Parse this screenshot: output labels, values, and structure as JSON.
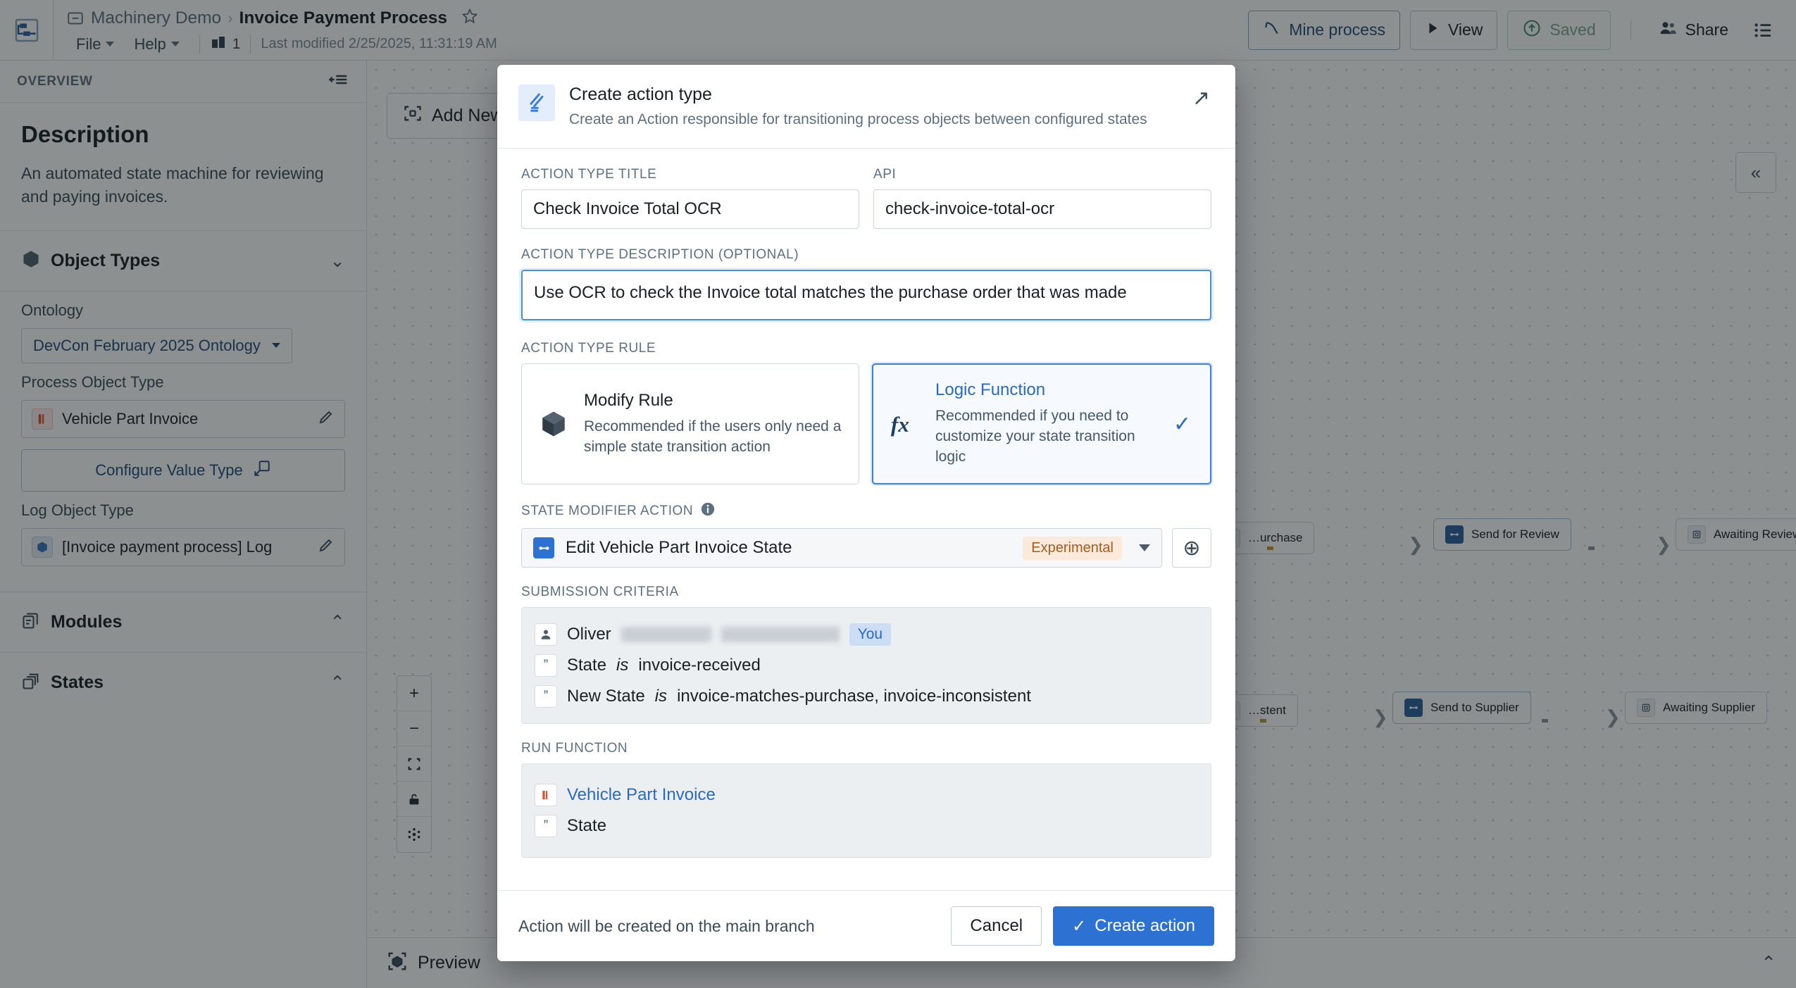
{
  "topbar": {
    "app_icon": "workflow-icon",
    "breadcrumb_parent": "Machinery Demo",
    "breadcrumb_sep": "›",
    "breadcrumb_current": "Invoice Payment Process",
    "star_icon": "star-outline-icon",
    "menu": [
      {
        "label": "File"
      },
      {
        "label": "Help"
      }
    ],
    "branch_count": "1",
    "last_modified": "Last modified 2/25/2025, 11:31:19 AM",
    "actions": {
      "mine_process": "Mine process",
      "view": "View",
      "saved": "Saved",
      "share": "Share",
      "list_icon": "list-menu-icon"
    }
  },
  "left_panel": {
    "header": "OVERVIEW",
    "collapse_icon": "panel-collapse-icon",
    "description_title": "Description",
    "description_text": "An automated state machine for reviewing and paying invoices.",
    "object_types": {
      "title": "Object Types",
      "chevron": "⌄",
      "ontology_label": "Ontology",
      "ontology_value": "DevCon February 2025 Ontology",
      "process_object_type_label": "Process Object Type",
      "process_object_type_value": "Vehicle Part Invoice",
      "configure_value_type": "Configure Value Type",
      "log_object_type_label": "Log Object Type",
      "log_object_type_value": "[Invoice payment process] Log"
    },
    "modules": {
      "title": "Modules",
      "chevron": "⌃"
    },
    "states": {
      "title": "States",
      "chevron": "⌃"
    }
  },
  "canvas": {
    "add_new": "Add New",
    "collapse_right_icon": "«",
    "zoom_controls": [
      "+",
      "−",
      "fit-icon",
      "lock-icon",
      "layout-icon"
    ],
    "nodes": [
      {
        "label": "…urchase",
        "kind": "state"
      },
      {
        "label": "Send for Review",
        "kind": "action"
      },
      {
        "label": "Awaiting Review",
        "kind": "state"
      },
      {
        "label": "…stent",
        "kind": "state"
      },
      {
        "label": "Send to Supplier",
        "kind": "action"
      },
      {
        "label": "Awaiting Supplier",
        "kind": "state"
      }
    ]
  },
  "bottombar": {
    "preview": "Preview",
    "chevron": "⌃"
  },
  "dialog": {
    "header": {
      "icon": "action-type-icon",
      "title": "Create action type",
      "subtitle": "Create an Action responsible for transitioning process objects between configured states",
      "expand_icon": "↗"
    },
    "fields": {
      "title_label": "ACTION TYPE TITLE",
      "title_value": "Check Invoice Total OCR",
      "api_label": "API",
      "api_value": "check-invoice-total-ocr",
      "description_label": "ACTION TYPE DESCRIPTION (OPTIONAL)",
      "description_value": "Use OCR to check the Invoice total matches the purchase order that was made"
    },
    "action_type_rule": {
      "label": "ACTION TYPE RULE",
      "options": [
        {
          "icon": "cube-icon",
          "title": "Modify Rule",
          "description": "Recommended if the users only need a simple state transition action",
          "selected": false
        },
        {
          "icon": "fx-icon",
          "title": "Logic Function",
          "description": "Recommended if you need to customize your state transition logic",
          "selected": true,
          "check": "✓"
        }
      ]
    },
    "state_modifier": {
      "label": "STATE MODIFIER ACTION",
      "info_icon": "info-icon",
      "value": "Edit Vehicle Part Invoice State",
      "tag": "Experimental",
      "add_icon": "⊕"
    },
    "submission_criteria": {
      "label": "SUBMISSION CRITERIA",
      "rows": [
        {
          "icon": "user-icon",
          "text": "Oliver",
          "redacted": true,
          "badge": "You"
        },
        {
          "icon": "quote-icon",
          "key": "State",
          "op": "is",
          "value": "invoice-received"
        },
        {
          "icon": "quote-icon",
          "key": "New State",
          "op": "is",
          "value": "invoice-matches-purchase, invoice-inconsistent"
        }
      ]
    },
    "run_function": {
      "label": "RUN FUNCTION",
      "rows": [
        {
          "icon": "invoice-icon",
          "text": "Vehicle Part Invoice",
          "link": true
        },
        {
          "icon": "quote-icon",
          "text": "State",
          "link": false
        }
      ]
    },
    "footer": {
      "note": "Action will be created on the main branch",
      "cancel": "Cancel",
      "create": "Create action",
      "create_check": "✓"
    }
  },
  "colors": {
    "accent_blue": "#2d72d2",
    "selected_blue": "#3b82d6",
    "experimental_tag_bg": "#fbeadb",
    "experimental_tag_fg": "#a45b1e",
    "link_blue": "#2a6abf"
  }
}
